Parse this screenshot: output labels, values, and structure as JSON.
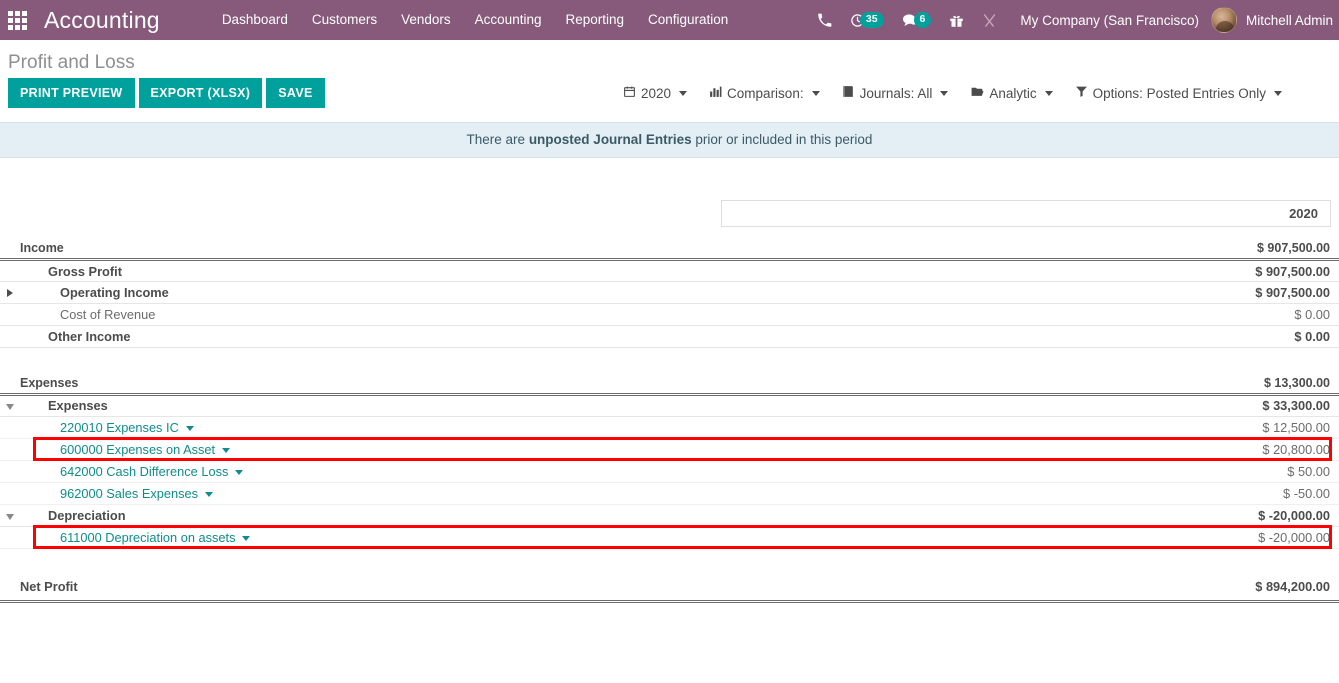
{
  "navbar": {
    "apps_icon": "apps-grid-icon",
    "brand": "Accounting",
    "menu_items": [
      {
        "label": "Dashboard"
      },
      {
        "label": "Customers"
      },
      {
        "label": "Vendors"
      },
      {
        "label": "Accounting"
      },
      {
        "label": "Reporting"
      },
      {
        "label": "Configuration"
      }
    ],
    "systray": [
      {
        "name": "phone-icon",
        "glyph": "✆",
        "badge": null
      },
      {
        "name": "activity-clock-icon",
        "glyph": "◴",
        "badge": "35"
      },
      {
        "name": "messages-icon",
        "glyph": "💬",
        "badge": "6"
      },
      {
        "name": "gift-icon",
        "glyph": "🎁",
        "badge": null
      },
      {
        "name": "debug-tools-icon",
        "glyph": "⚒",
        "badge": null
      }
    ],
    "company": "My Company (San Francisco)",
    "user": "Mitchell Admin",
    "colors": {
      "brand_purple": "#875A7B",
      "badge_teal": "#00A09D"
    }
  },
  "control_panel": {
    "title": "Profit and Loss",
    "buttons": [
      {
        "label": "PRINT PREVIEW",
        "name": "print-preview-button"
      },
      {
        "label": "EXPORT (XLSX)",
        "name": "export-xlsx-button"
      },
      {
        "label": "SAVE",
        "name": "save-button"
      }
    ],
    "button_color": "#00A09D",
    "filters": [
      {
        "label": "2020",
        "icon": "calendar-icon",
        "glyph": "📅",
        "name": "date-filter"
      },
      {
        "label": "Comparison:",
        "icon": "bar-chart-icon",
        "glyph": "📊",
        "name": "comparison-filter"
      },
      {
        "label": "Journals: All",
        "icon": "book-icon",
        "glyph": "📕",
        "name": "journals-filter"
      },
      {
        "label": "Analytic",
        "icon": "folder-open-icon",
        "glyph": "📂",
        "name": "analytic-filter"
      },
      {
        "label": "Options: Posted Entries Only",
        "icon": "funnel-icon",
        "glyph": "▼",
        "name": "options-filter"
      }
    ]
  },
  "banner": {
    "prefix": "There are ",
    "strong": "unposted Journal Entries",
    "suffix": " prior or included in this period",
    "background": "#E3EFF5"
  },
  "report": {
    "column_header": "2020",
    "rows": [
      {
        "type": "section-head",
        "label": "Income",
        "value": "$ 907,500.00",
        "indent": 0,
        "toggle": null
      },
      {
        "type": "total",
        "label": "Gross Profit",
        "value": "$ 907,500.00",
        "indent": 1,
        "toggle": null
      },
      {
        "type": "total",
        "label": "Operating Income",
        "value": "$ 907,500.00",
        "indent": 1,
        "toggle": "collapsed"
      },
      {
        "type": "line",
        "label": "Cost of Revenue",
        "value": "$ 0.00",
        "indent": 1,
        "toggle": null
      },
      {
        "type": "total",
        "label": "Other Income",
        "value": "$ 0.00",
        "indent": 1,
        "toggle": null
      },
      {
        "type": "spacer"
      },
      {
        "type": "section-head",
        "label": "Expenses",
        "value": "$ 13,300.00",
        "indent": 0,
        "toggle": null
      },
      {
        "type": "total",
        "label": "Expenses",
        "value": "$ 33,300.00",
        "indent": 1,
        "toggle": "expanded"
      },
      {
        "type": "account",
        "label": "220010 Expenses IC",
        "value": "$ 12,500.00",
        "indent": 2,
        "toggle": null,
        "highlight": false
      },
      {
        "type": "account",
        "label": "600000 Expenses on Asset",
        "value": "$ 20,800.00",
        "indent": 2,
        "toggle": null,
        "highlight": true
      },
      {
        "type": "account",
        "label": "642000 Cash Difference Loss",
        "value": "$ 50.00",
        "indent": 2,
        "toggle": null,
        "highlight": false
      },
      {
        "type": "account",
        "label": "962000 Sales Expenses",
        "value": "$ -50.00",
        "indent": 2,
        "toggle": null,
        "highlight": false
      },
      {
        "type": "total",
        "label": "Depreciation",
        "value": "$ -20,000.00",
        "indent": 1,
        "toggle": "expanded"
      },
      {
        "type": "account",
        "label": "611000 Depreciation on assets",
        "value": "$ -20,000.00",
        "indent": 2,
        "toggle": null,
        "highlight": true
      },
      {
        "type": "spacer"
      },
      {
        "type": "net",
        "label": "Net Profit",
        "value": "$ 894,200.00",
        "indent": 0,
        "toggle": null
      }
    ],
    "highlight_color": "#FF0000",
    "account_link_color": "#0F8C8C"
  }
}
